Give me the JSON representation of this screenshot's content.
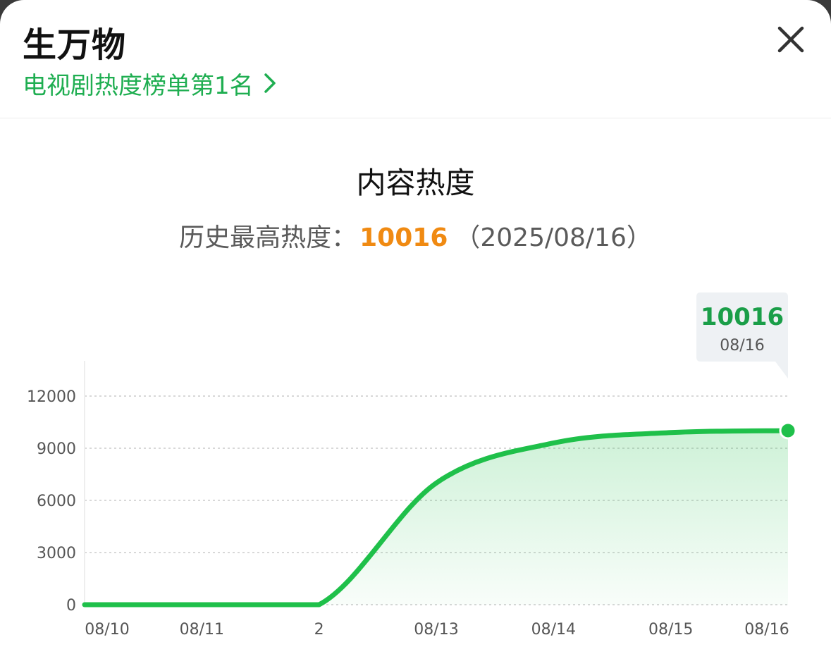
{
  "header": {
    "title": "生万物",
    "rank_link": "电视剧热度榜单第1名"
  },
  "icons": {
    "close": "close-icon",
    "chevron": "chevron-right-icon"
  },
  "colors": {
    "accent": "#1fae51",
    "line": "#1fc04a",
    "peak": "#f08a12"
  },
  "summary": {
    "prefix": "历史最高热度：",
    "peak": "10016",
    "date": "（2025/08/16）"
  },
  "chart_data": {
    "type": "area",
    "title": "内容热度",
    "x": [
      "08/10",
      "08/11",
      "08/12",
      "08/13",
      "08/14",
      "08/15",
      "08/16"
    ],
    "x_tick_labels": [
      "08/10",
      "08/11",
      "2",
      "08/13",
      "08/14",
      "08/15",
      "08/16"
    ],
    "values": [
      0,
      0,
      0,
      7000,
      9300,
      9900,
      10016
    ],
    "ylim": [
      0,
      12000
    ],
    "yticks": [
      0,
      3000,
      6000,
      9000,
      12000
    ],
    "grid": true,
    "tooltip": {
      "value": "10016",
      "date": "08/16"
    }
  }
}
